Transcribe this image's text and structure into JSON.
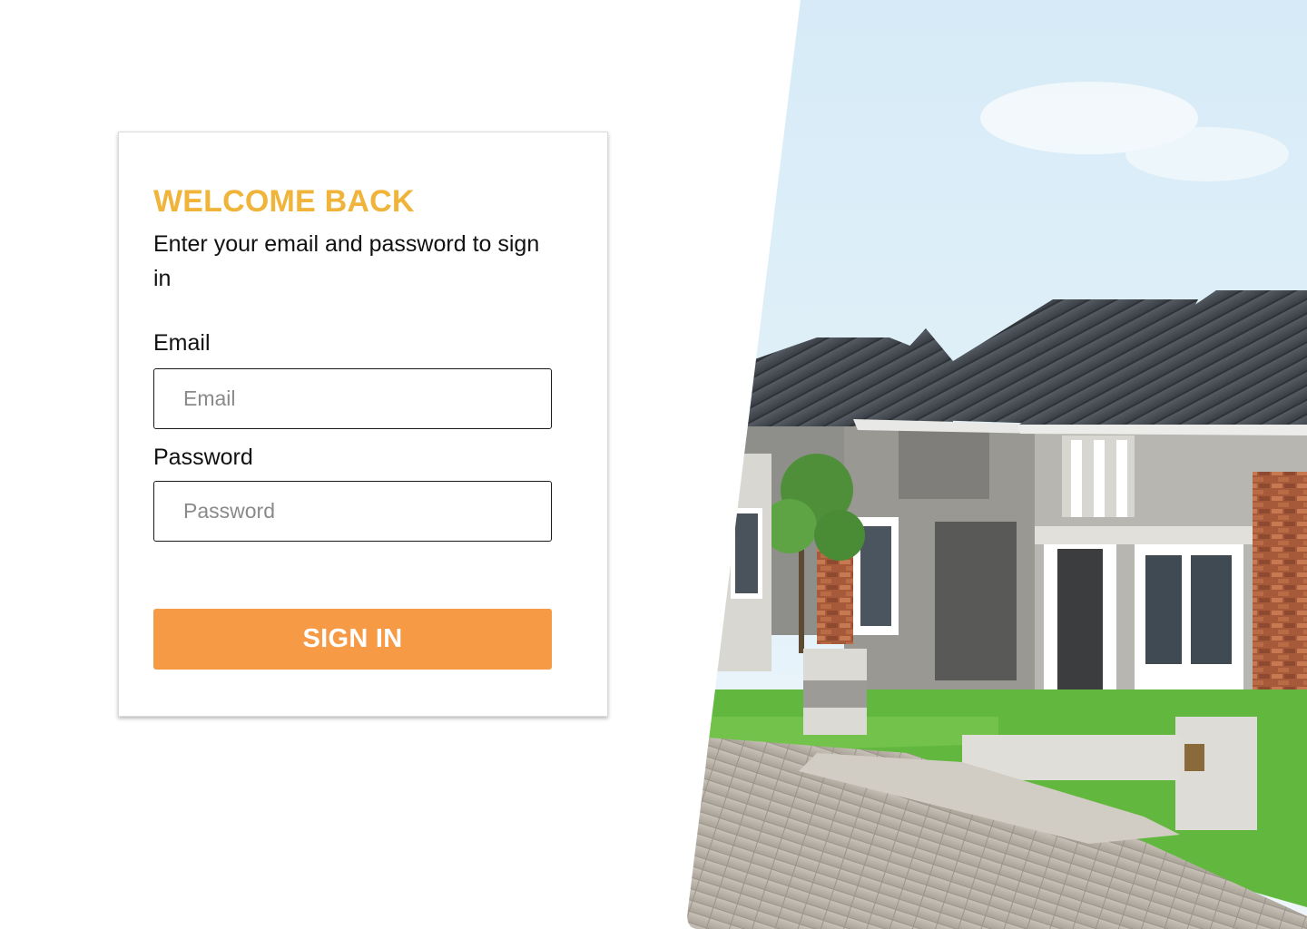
{
  "colors": {
    "title": "#f0b43a",
    "button": "#f79a45",
    "sky": "#cfe7f6",
    "grass": "#62b83f",
    "paving": "#bdb6ad"
  },
  "login": {
    "title": "WELCOME BACK",
    "subtitle": "Enter your email and password to sign in",
    "email_label": "Email",
    "email_placeholder": "Email",
    "email_value": "",
    "password_label": "Password",
    "password_placeholder": "Password",
    "password_value": "",
    "submit_label": "SIGN IN"
  },
  "hero": {
    "image_subject": "row-of-houses-photo"
  }
}
